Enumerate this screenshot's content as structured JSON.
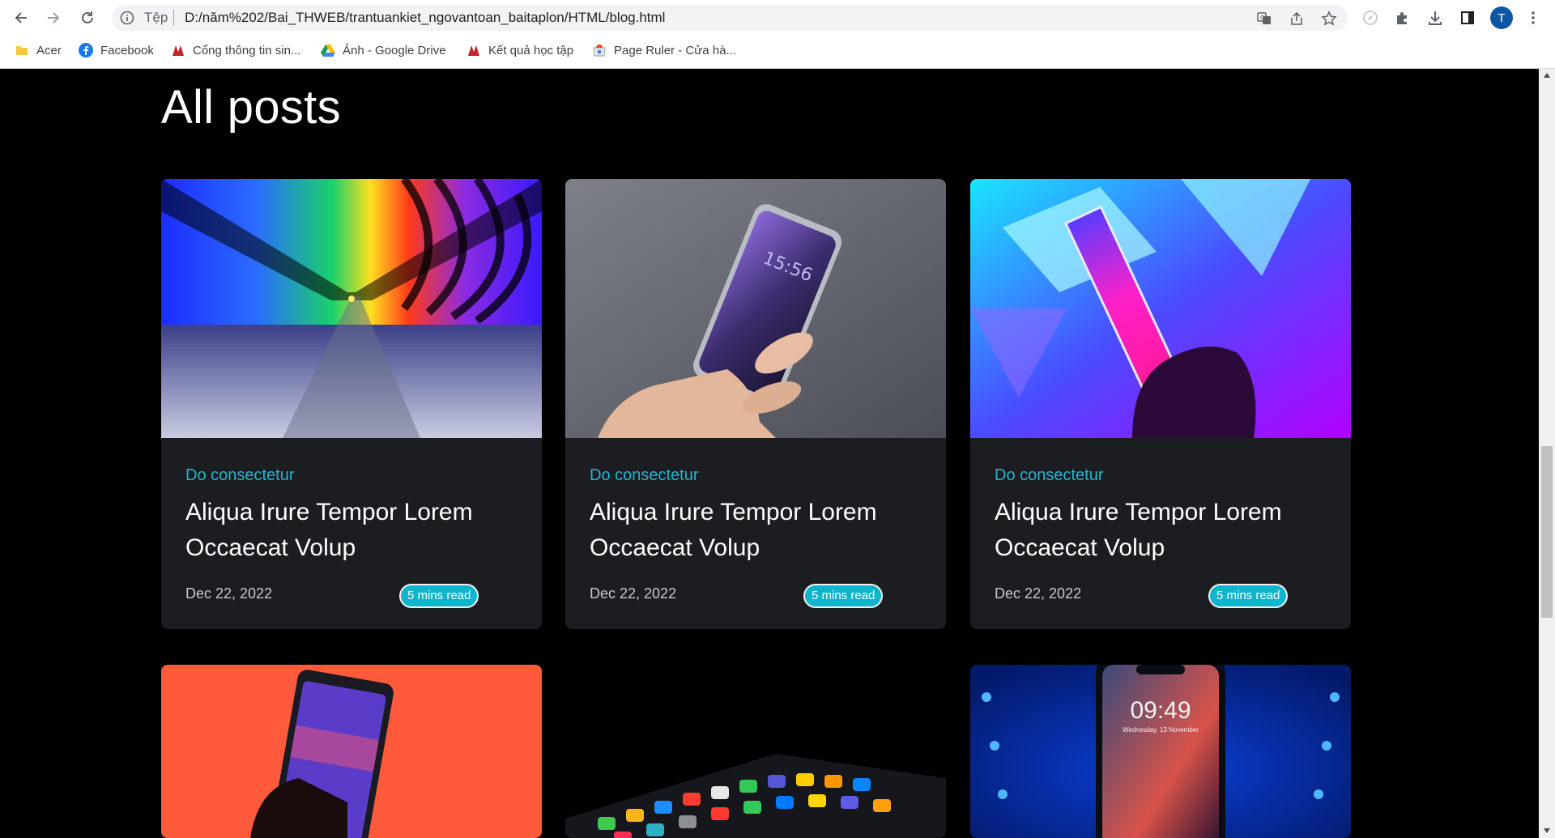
{
  "browser": {
    "omnibox": {
      "scheme": "Tệp",
      "url": "D:/năm%202/Bai_THWEB/trantuankiet_ngovantoan_baitaplon/HTML/blog.html"
    },
    "profile_initial": "T",
    "bookmarks": [
      {
        "label": "Acer",
        "icon": "folder-icon"
      },
      {
        "label": "Facebook",
        "icon": "facebook-icon"
      },
      {
        "label": "Cổng thông tin sin...",
        "icon": "school-logo-icon"
      },
      {
        "label": "Ảnh - Google Drive",
        "icon": "google-drive-icon"
      },
      {
        "label": "Kết quả học tập",
        "icon": "school-logo-icon"
      },
      {
        "label": "Page Ruler - Cửa hà...",
        "icon": "webstore-icon"
      }
    ]
  },
  "page": {
    "heading": "All posts",
    "posts": [
      {
        "category": "Do consectetur",
        "title": "Aliqua Irure Tempor Lorem Occaecat Volup",
        "date": "Dec 22, 2022",
        "read_time": "5 mins read",
        "image": "rainbow-tunnel"
      },
      {
        "category": "Do consectetur",
        "title": "Aliqua Irure Tempor Lorem Occaecat Volup",
        "date": "Dec 22, 2022",
        "read_time": "5 mins read",
        "image": "hand-holding-phone"
      },
      {
        "category": "Do consectetur",
        "title": "Aliqua Irure Tempor Lorem Occaecat Volup",
        "date": "Dec 22, 2022",
        "read_time": "5 mins read",
        "image": "neon-light-bar"
      },
      {
        "image": "phone-on-orange"
      },
      {
        "image": "app-icons-dark"
      },
      {
        "image": "iphone-blue-lights",
        "clock": "09:49",
        "clock_date": "Wednesday, 13 November"
      }
    ]
  },
  "colors": {
    "accent": "#0fb5cc",
    "category": "#22b6cc",
    "card_bg": "#1b1d21",
    "page_bg": "#000000"
  }
}
